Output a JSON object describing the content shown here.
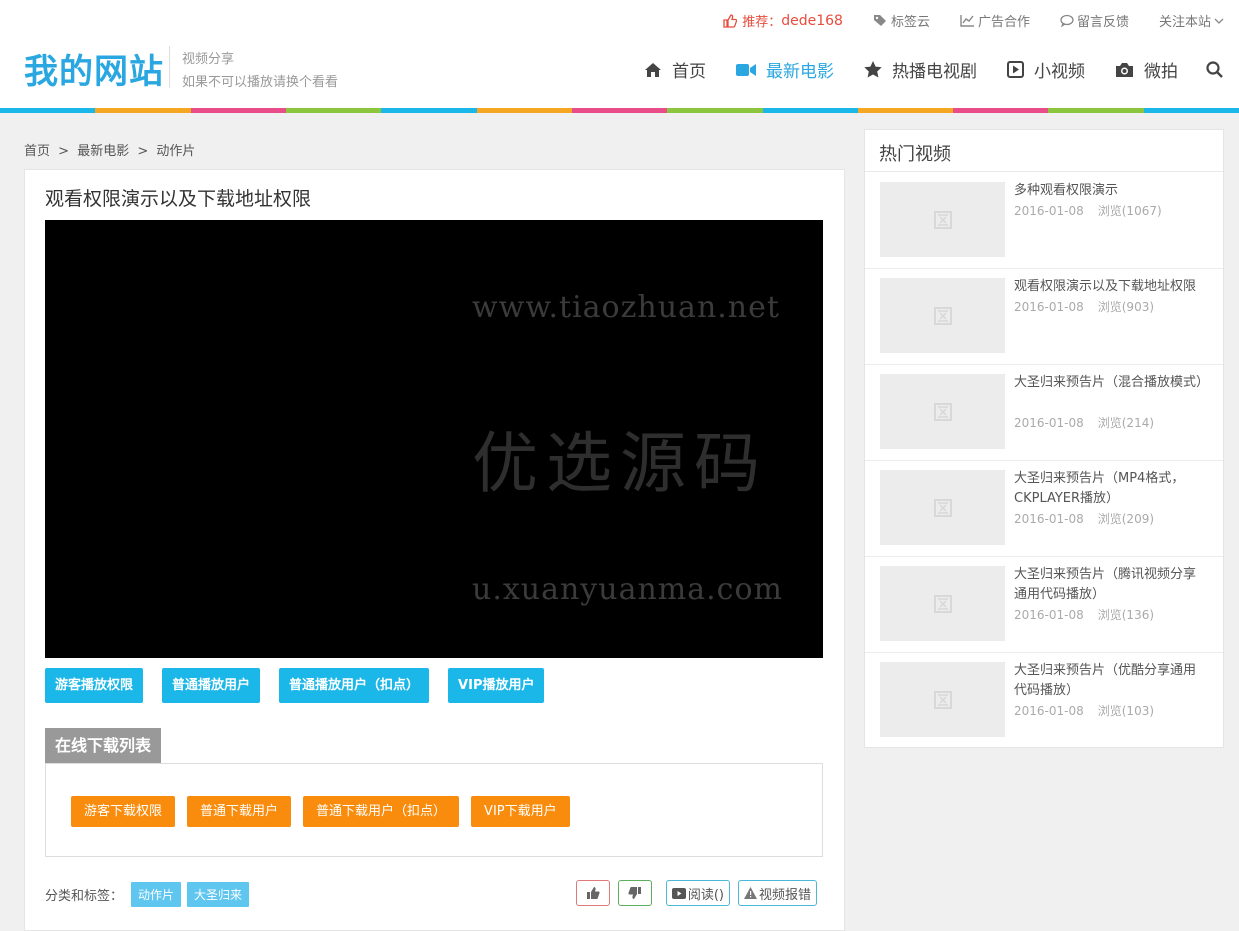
{
  "topbar": {
    "recommend_label": "推荐：",
    "recommend_user": "dede168",
    "tags_cloud": "标签云",
    "ad": "广告合作",
    "feedback": "留言反馈",
    "follow": "关注本站"
  },
  "logo": "我的网站",
  "slogan": {
    "line1": "视频分享",
    "line2": "如果不可以播放请换个看看"
  },
  "nav": [
    {
      "label": "首页",
      "icon": "home-icon"
    },
    {
      "label": "最新电影",
      "icon": "video-camera-icon",
      "active": true
    },
    {
      "label": "热播电视剧",
      "icon": "star-icon"
    },
    {
      "label": "小视频",
      "icon": "play-square-icon"
    },
    {
      "label": "微拍",
      "icon": "camera-icon"
    }
  ],
  "stripe_colors": [
    "#1bb7e8",
    "#f5a623",
    "#e84d8a",
    "#8cc63f",
    "#1bb7e8",
    "#f5a623",
    "#e84d8a",
    "#8cc63f",
    "#1bb7e8",
    "#f5a623",
    "#e84d8a",
    "#8cc63f",
    "#1bb7e8"
  ],
  "breadcrumb": {
    "home": "首页",
    "sep": ">",
    "category": "最新电影",
    "sub": "动作片"
  },
  "article": {
    "title": "观看权限演示以及下载地址权限",
    "watermark": {
      "line1": "www.tiaozhuan.net",
      "line2": "优选源码",
      "line3": "u.xuanyuanma.com"
    },
    "play_buttons": [
      "游客播放权限",
      "普通播放用户",
      "普通播放用户（扣点）",
      "VIP播放用户"
    ],
    "download_title": "在线下载列表",
    "download_buttons": [
      "游客下载权限",
      "普通下载用户",
      "普通下载用户（扣点）",
      "VIP下载用户"
    ],
    "tags_label": "分类和标签：",
    "tags": [
      "动作片",
      "大圣归来"
    ],
    "read_label": "阅读()",
    "report_label": "视频报错"
  },
  "sidebar": {
    "title": "热门视频",
    "items": [
      {
        "title": "多种观看权限演示",
        "date": "2016-01-08",
        "views": "浏览(1067)"
      },
      {
        "title": "观看权限演示以及下载地址权限",
        "date": "2016-01-08",
        "views": "浏览(903)"
      },
      {
        "title": "大圣归来预告片（混合播放模式）",
        "date": "2016-01-08",
        "views": "浏览(214)"
      },
      {
        "title": "大圣归来预告片（MP4格式，CKPLAYER播放）",
        "date": "2016-01-08",
        "views": "浏览(209)"
      },
      {
        "title": "大圣归来预告片（腾讯视频分享通用代码播放）",
        "date": "2016-01-08",
        "views": "浏览(136)"
      },
      {
        "title": "大圣归来预告片（优酷分享通用代码播放）",
        "date": "2016-01-08",
        "views": "浏览(103)"
      }
    ]
  },
  "colors": {
    "accent": "#2aa7e0",
    "play_button": "#1bb7e8",
    "download_button": "#f98c0c",
    "recommend": "#e74c3c"
  }
}
